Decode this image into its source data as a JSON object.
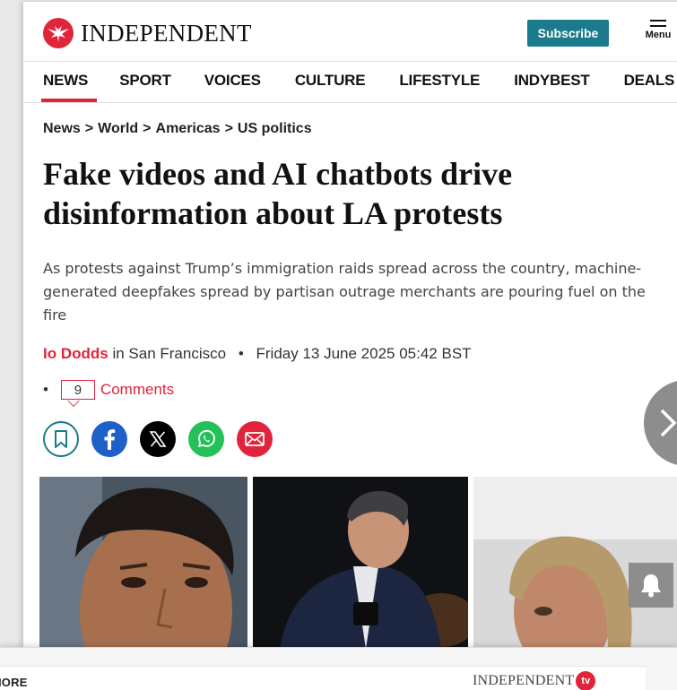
{
  "header": {
    "logo_text": "INDEPENDENT",
    "subscribe_label": "Subscribe",
    "menu_label": "Menu"
  },
  "nav": {
    "items": [
      {
        "label": "NEWS",
        "active": true
      },
      {
        "label": "SPORT"
      },
      {
        "label": "VOICES"
      },
      {
        "label": "CULTURE"
      },
      {
        "label": "LIFESTYLE"
      },
      {
        "label": "INDYBEST"
      },
      {
        "label": "DEALS"
      }
    ]
  },
  "breadcrumb": [
    "News",
    "World",
    "Americas",
    "US politics"
  ],
  "article": {
    "headline": "Fake videos and AI chatbots drive disinformation about LA protests",
    "standfirst": "As protests against Trump’s immigration raids spread across the country, machine-generated deepfakes spread by partisan outrage merchants are pouring fuel on the fire",
    "author": "Io Dodds",
    "location": "in San Francisco",
    "date": "Friday 13 June 2025 05:42 BST",
    "comment_count": "9",
    "comments_label": "Comments"
  },
  "share": [
    "bookmark-icon",
    "facebook-icon",
    "x-icon",
    "whatsapp-icon",
    "email-icon"
  ],
  "bottom_panel": {
    "more_label": "IORE",
    "tv_logo_text": "INDEPENDENT",
    "tv_badge": "tv"
  },
  "colors": {
    "brand_red": "#e0243b",
    "teal": "#1b7b8c",
    "facebook": "#1f5fc8",
    "whatsapp": "#24c05a"
  }
}
